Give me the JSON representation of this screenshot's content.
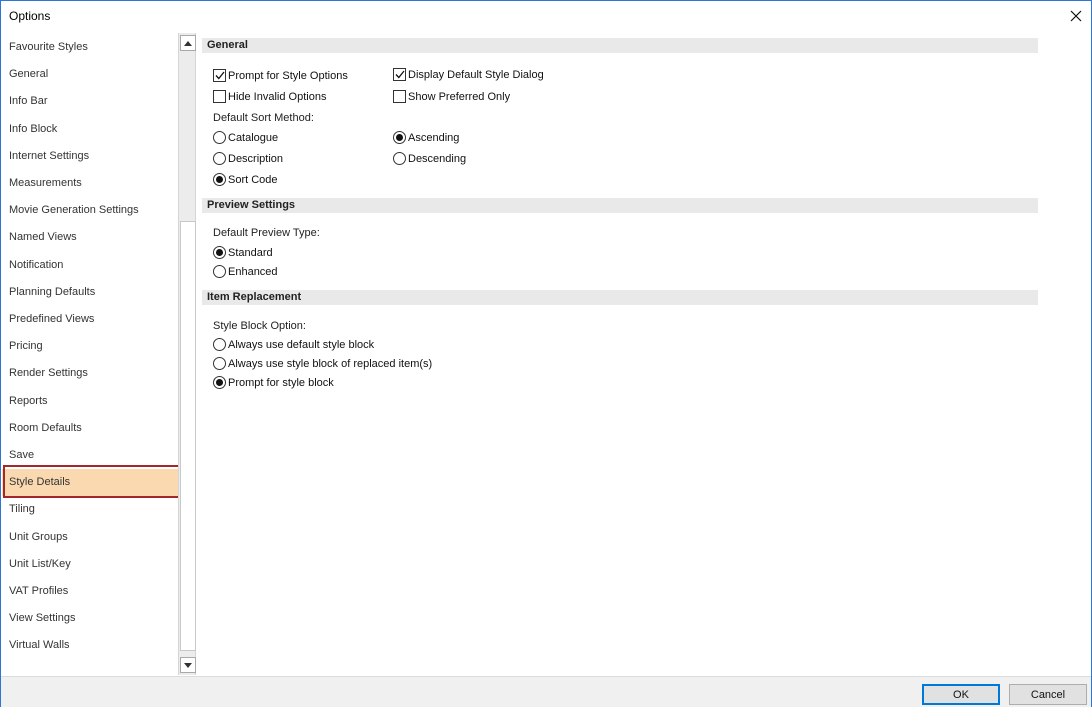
{
  "window": {
    "title": "Options"
  },
  "icons": {
    "close": "close-icon",
    "scroll_up": "arrow-up-icon",
    "scroll_down": "arrow-down-icon"
  },
  "colors": {
    "selected_bg": "#fbd9b0",
    "highlight_border": "#a3262b",
    "ok_border": "#0078d7"
  },
  "sidebar": {
    "items": [
      {
        "label": "Favourite Styles",
        "selected": false
      },
      {
        "label": "General",
        "selected": false
      },
      {
        "label": "Info Bar",
        "selected": false
      },
      {
        "label": "Info Block",
        "selected": false
      },
      {
        "label": "Internet Settings",
        "selected": false
      },
      {
        "label": "Measurements",
        "selected": false
      },
      {
        "label": "Movie Generation Settings",
        "selected": false
      },
      {
        "label": "Named Views",
        "selected": false
      },
      {
        "label": "Notification",
        "selected": false
      },
      {
        "label": "Planning Defaults",
        "selected": false
      },
      {
        "label": "Predefined Views",
        "selected": false
      },
      {
        "label": "Pricing",
        "selected": false
      },
      {
        "label": "Render Settings",
        "selected": false
      },
      {
        "label": "Reports",
        "selected": false
      },
      {
        "label": "Room Defaults",
        "selected": false
      },
      {
        "label": "Save",
        "selected": false
      },
      {
        "label": "Style Details",
        "selected": true
      },
      {
        "label": "Tiling",
        "selected": false
      },
      {
        "label": "Unit Groups",
        "selected": false
      },
      {
        "label": "Unit List/Key",
        "selected": false
      },
      {
        "label": "VAT Profiles",
        "selected": false
      },
      {
        "label": "View Settings",
        "selected": false
      },
      {
        "label": "Virtual Walls",
        "selected": false
      }
    ]
  },
  "general": {
    "heading": "General",
    "prompt_style_options": {
      "label": "Prompt for Style Options",
      "checked": true
    },
    "display_default_style_dialog": {
      "label": "Display Default Style Dialog",
      "checked": true
    },
    "hide_invalid_options": {
      "label": "Hide Invalid Options",
      "checked": false
    },
    "show_preferred_only": {
      "label": "Show Preferred Only",
      "checked": false
    },
    "sort_method_label": "Default Sort Method:",
    "catalogue": {
      "label": "Catalogue",
      "selected": false
    },
    "description": {
      "label": "Description",
      "selected": false
    },
    "sort_code": {
      "label": "Sort Code",
      "selected": true
    },
    "ascending": {
      "label": "Ascending",
      "selected": true
    },
    "descending": {
      "label": "Descending",
      "selected": false
    }
  },
  "preview": {
    "heading": "Preview Settings",
    "type_label": "Default Preview Type:",
    "standard": {
      "label": "Standard",
      "selected": true
    },
    "enhanced": {
      "label": "Enhanced",
      "selected": false
    }
  },
  "replacement": {
    "heading": "Item Replacement",
    "option_label": "Style Block Option:",
    "always_default": {
      "label": "Always use default style block",
      "selected": false
    },
    "always_replaced": {
      "label": "Always use style block of replaced item(s)",
      "selected": false
    },
    "prompt": {
      "label": "Prompt for style block",
      "selected": true
    }
  },
  "footer": {
    "ok": "OK",
    "cancel": "Cancel"
  }
}
